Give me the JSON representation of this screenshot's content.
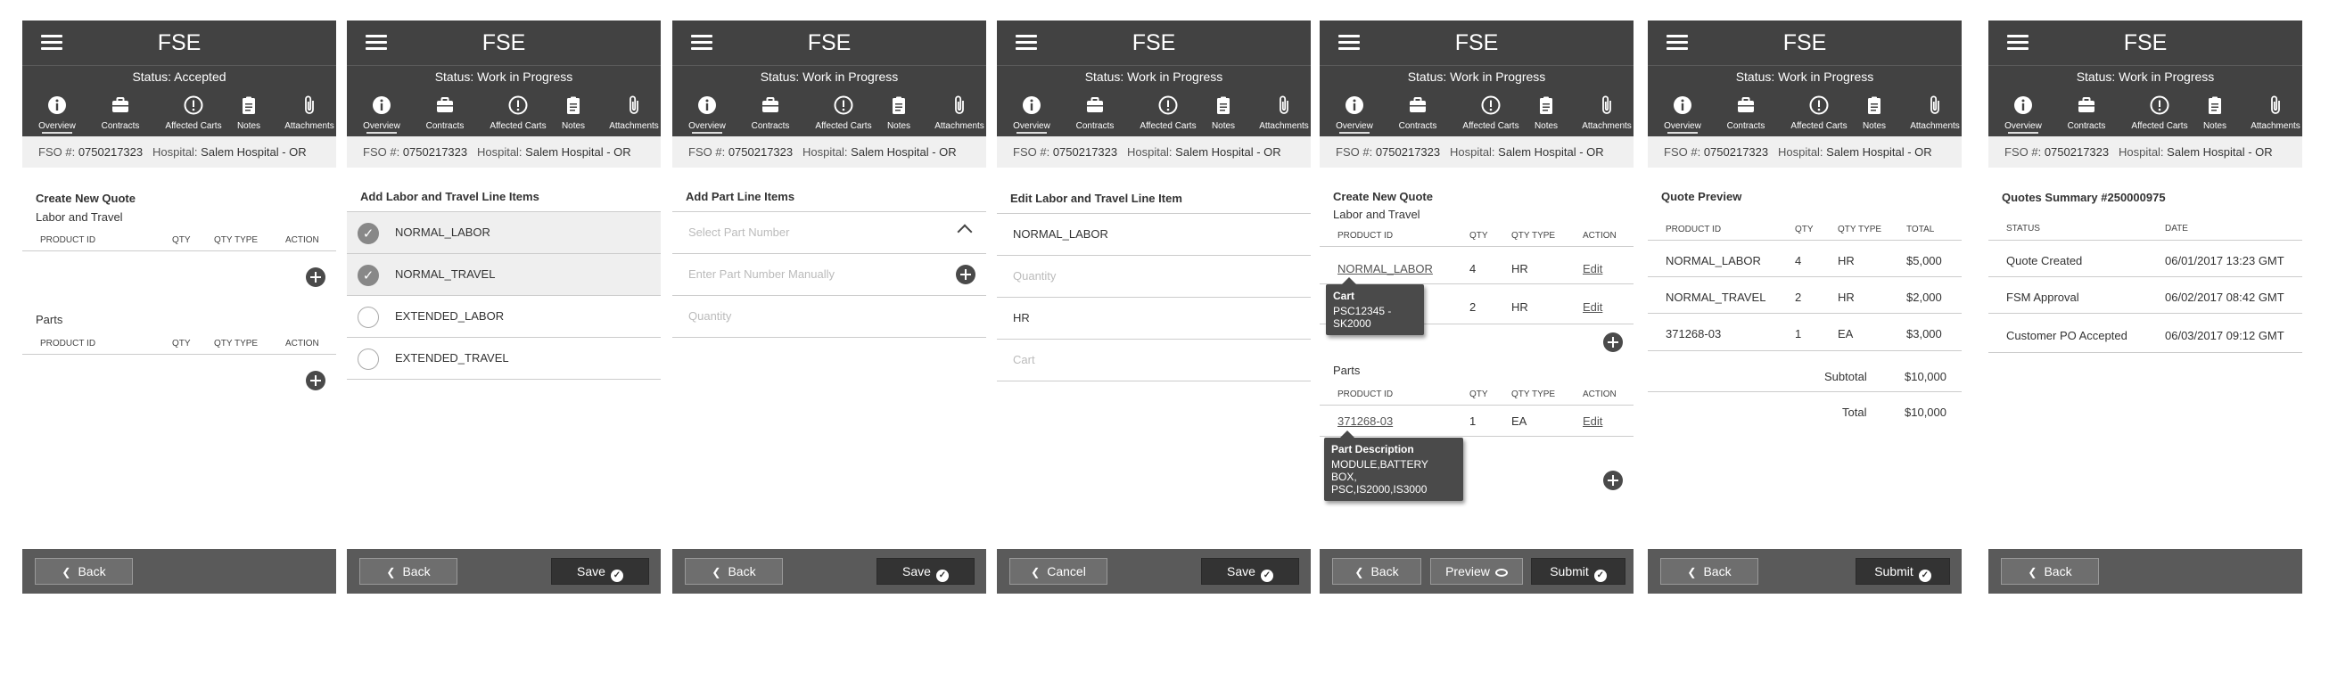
{
  "app": {
    "title": "FSE",
    "tabs": [
      "Overview",
      "Contracts",
      "Affected Carts",
      "Notes",
      "Attachments"
    ],
    "tab_icons": [
      "info-icon",
      "briefcase-icon",
      "alert-icon",
      "clipboard-icon",
      "paperclip-icon"
    ],
    "fso_label": "FSO #:",
    "fso_value": "0750217323",
    "hospital_label": "Hospital:",
    "hospital_value": "Salem Hospital - OR"
  },
  "panels": [
    {
      "status": "Status: Accepted",
      "section": "Create New Quote",
      "labor_title": "Labor and Travel",
      "parts_title": "Parts",
      "cols": [
        "PRODUCT ID",
        "QTY",
        "QTY TYPE",
        "ACTION"
      ],
      "back": "Back"
    },
    {
      "status": "Status: Work in Progress",
      "section": "Add Labor and Travel Line Items",
      "items": [
        {
          "label": "NORMAL_LABOR",
          "checked": true
        },
        {
          "label": "NORMAL_TRAVEL",
          "checked": true
        },
        {
          "label": "EXTENDED_LABOR",
          "checked": false
        },
        {
          "label": "EXTENDED_TRAVEL",
          "checked": false
        }
      ],
      "back": "Back",
      "save": "Save"
    },
    {
      "status": "Status: Work in Progress",
      "section": "Add Part Line Items",
      "select_placeholder": "Select Part Number",
      "manual_placeholder": "Enter Part Number Manually",
      "qty_placeholder": "Quantity",
      "back": "Back",
      "save": "Save"
    },
    {
      "status": "Status: Work in Progress",
      "section": "Edit Labor and Travel Line Item",
      "product_value": "NORMAL_LABOR",
      "qty_placeholder": "Quantity",
      "qty_type_value": "HR",
      "cart_placeholder": "Cart",
      "cancel": "Cancel",
      "save": "Save"
    },
    {
      "status": "Status: Work in Progress",
      "section": "Create New Quote",
      "labor_title": "Labor and Travel",
      "parts_title": "Parts",
      "cols": [
        "PRODUCT ID",
        "QTY",
        "QTY TYPE",
        "ACTION"
      ],
      "labor_rows": [
        {
          "id": "NORMAL_LABOR",
          "qty": "4",
          "type": "HR",
          "action": "Edit"
        },
        {
          "id": "",
          "qty": "2",
          "type": "HR",
          "action": "Edit"
        }
      ],
      "parts_rows": [
        {
          "id": "371268-03",
          "qty": "1",
          "type": "EA",
          "action": "Edit"
        }
      ],
      "cart_tip_title": "Cart",
      "cart_tip_text": "PSC12345 - SK2000",
      "part_tip_title": "Part Description",
      "part_tip_line1": "MODULE,BATTERY BOX,",
      "part_tip_line2": "PSC,IS2000,IS3000",
      "back": "Back",
      "preview": "Preview",
      "submit": "Submit"
    },
    {
      "status": "Status: Work in Progress",
      "section": "Quote Preview",
      "cols": [
        "PRODUCT ID",
        "QTY",
        "QTY TYPE",
        "TOTAL"
      ],
      "rows": [
        {
          "id": "NORMAL_LABOR",
          "qty": "4",
          "type": "HR",
          "total": "$5,000"
        },
        {
          "id": "NORMAL_TRAVEL",
          "qty": "2",
          "type": "HR",
          "total": "$2,000"
        },
        {
          "id": "371268-03",
          "qty": "1",
          "type": "EA",
          "total": "$3,000"
        }
      ],
      "subtotal_label": "Subtotal",
      "subtotal_value": "$10,000",
      "total_label": "Total",
      "total_value": "$10,000",
      "back": "Back",
      "submit": "Submit"
    },
    {
      "status": "Status: Work in Progress",
      "section": "Quotes Summary #250000975",
      "cols": [
        "STATUS",
        "DATE"
      ],
      "rows": [
        {
          "status": "Quote Created",
          "date": "06/01/2017 13:23 GMT"
        },
        {
          "status": "FSM Approval",
          "date": "06/02/2017 08:42 GMT"
        },
        {
          "status": "Customer PO Accepted",
          "date": "06/03/2017 09:12 GMT"
        }
      ],
      "back": "Back"
    }
  ]
}
